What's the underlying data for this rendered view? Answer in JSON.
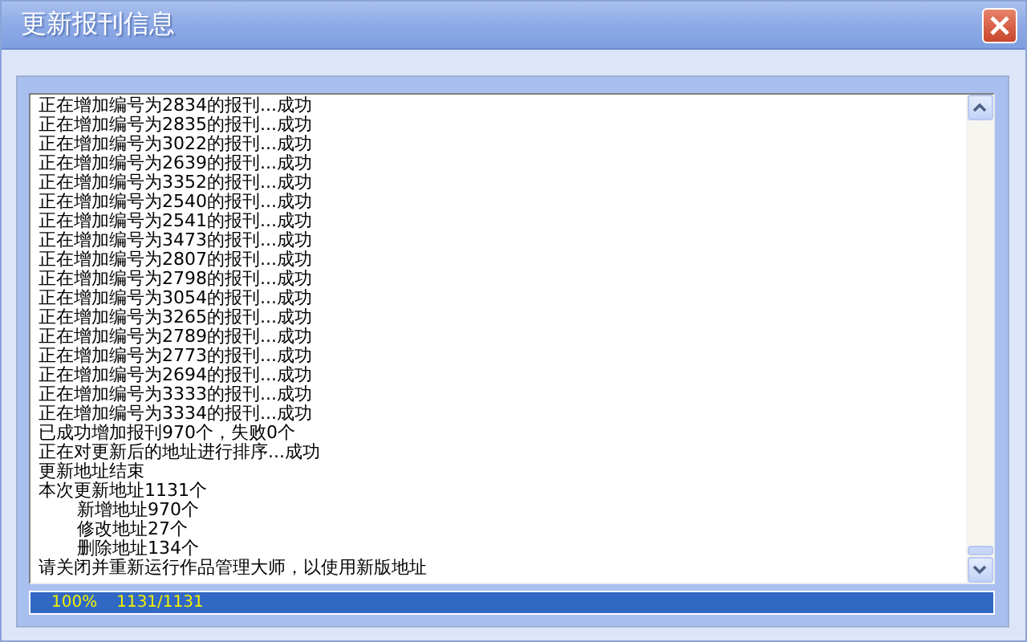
{
  "window": {
    "title": "更新报刊信息"
  },
  "log": [
    {
      "kind": "line",
      "text": "正在增加编号为2834的报刊...成功"
    },
    {
      "kind": "line",
      "text": "正在增加编号为2835的报刊...成功"
    },
    {
      "kind": "line",
      "text": "正在增加编号为3022的报刊...成功"
    },
    {
      "kind": "line",
      "text": "正在增加编号为2639的报刊...成功"
    },
    {
      "kind": "line",
      "text": "正在增加编号为3352的报刊...成功"
    },
    {
      "kind": "line",
      "text": "正在增加编号为2540的报刊...成功"
    },
    {
      "kind": "line",
      "text": "正在增加编号为2541的报刊...成功"
    },
    {
      "kind": "line",
      "text": "正在增加编号为3473的报刊...成功"
    },
    {
      "kind": "line",
      "text": "正在增加编号为2807的报刊...成功"
    },
    {
      "kind": "line",
      "text": "正在增加编号为2798的报刊...成功"
    },
    {
      "kind": "line",
      "text": "正在增加编号为3054的报刊...成功"
    },
    {
      "kind": "line",
      "text": "正在增加编号为3265的报刊...成功"
    },
    {
      "kind": "line",
      "text": "正在增加编号为2789的报刊...成功"
    },
    {
      "kind": "line",
      "text": "正在增加编号为2773的报刊...成功"
    },
    {
      "kind": "line",
      "text": "正在增加编号为2694的报刊...成功"
    },
    {
      "kind": "line",
      "text": "正在增加编号为3333的报刊...成功"
    },
    {
      "kind": "line",
      "text": "正在增加编号为3334的报刊...成功"
    },
    {
      "kind": "line",
      "text": "已成功增加报刊970个，失败0个"
    },
    {
      "kind": "line",
      "text": "正在对更新后的地址进行排序...成功"
    },
    {
      "kind": "line",
      "text": "更新地址结束"
    },
    {
      "kind": "line",
      "text": "本次更新地址1131个"
    },
    {
      "kind": "sub",
      "text": "新增地址970个"
    },
    {
      "kind": "sub",
      "text": "修改地址27个"
    },
    {
      "kind": "sub",
      "text": "删除地址134个"
    },
    {
      "kind": "line",
      "text": "请关闭并重新运行作品管理大师，以使用新版地址"
    }
  ],
  "progress": {
    "level": 1,
    "percent": "100%",
    "count": "1131/1131"
  }
}
